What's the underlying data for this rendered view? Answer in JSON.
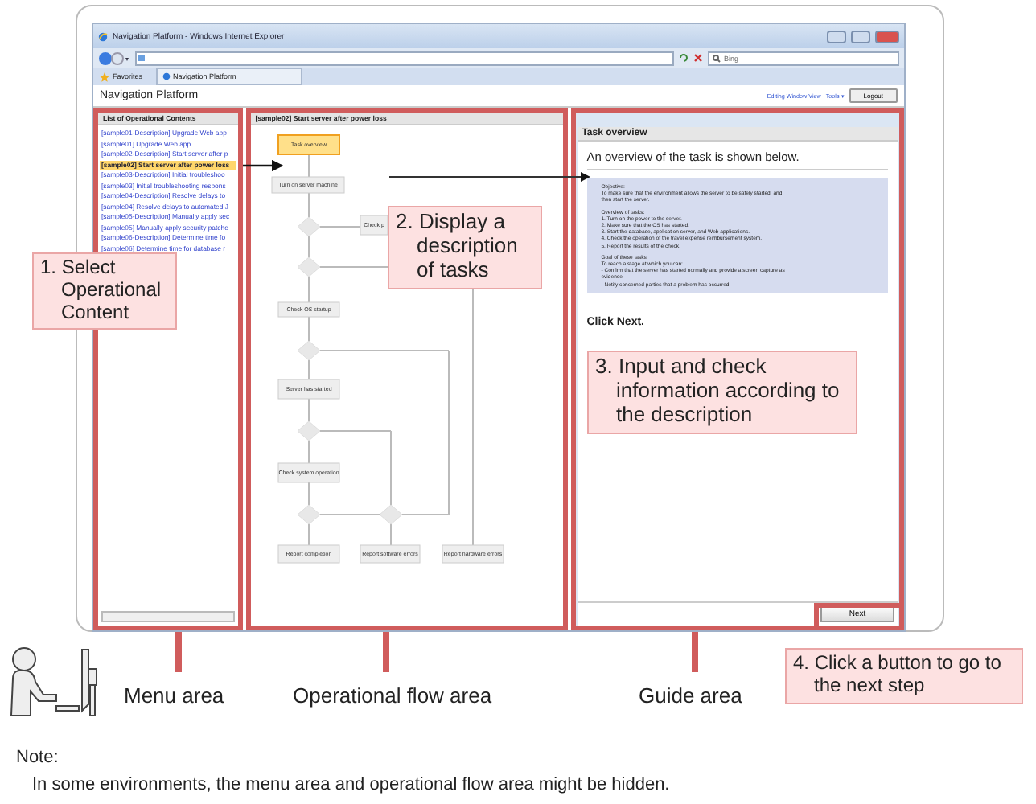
{
  "browser": {
    "title": "Navigation Platform - Windows Internet Explorer",
    "search_placeholder": "Bing",
    "favorites": "Favorites",
    "tab": "Navigation Platform"
  },
  "app": {
    "title": "Navigation Platform",
    "links": [
      "Editing Window View",
      "Tools ▾"
    ],
    "logout": "Logout"
  },
  "menu": {
    "heading": "List of Operational Contents",
    "items": [
      {
        "label": "[sample01-Description] Upgrade Web app",
        "selected": false
      },
      {
        "label": "[sample01] Upgrade Web app",
        "selected": false
      },
      {
        "label": "[sample02-Description] Start server after p",
        "selected": false
      },
      {
        "label": "[sample02] Start server after power loss",
        "selected": true
      },
      {
        "label": "[sample03-Description] Initial troubleshoo",
        "selected": false
      },
      {
        "label": "[sample03] Initial troubleshooting respons",
        "selected": false
      },
      {
        "label": "[sample04-Description] Resolve delays to",
        "selected": false
      },
      {
        "label": "[sample04] Resolve delays to automated J",
        "selected": false
      },
      {
        "label": "[sample05-Description] Manually apply sec",
        "selected": false
      },
      {
        "label": "[sample05] Manually apply security patche",
        "selected": false
      },
      {
        "label": "[sample06-Description] Determine time fo",
        "selected": false
      },
      {
        "label": "[sample06] Determine time for database r",
        "selected": false
      }
    ]
  },
  "flow": {
    "heading": "[sample02] Start server after power loss",
    "nodes": [
      {
        "label": "Task overview",
        "selected": true
      },
      {
        "label": "Turn on server machine",
        "selected": false
      },
      {
        "label": "Check p",
        "selected": false
      },
      {
        "label": "Check OS startup",
        "selected": false
      },
      {
        "label": "Server has started",
        "selected": false
      },
      {
        "label": "Check system operation",
        "selected": false
      },
      {
        "label": "Report completion",
        "selected": false
      },
      {
        "label": "Report software errors",
        "selected": false
      },
      {
        "label": "Report hardware errors",
        "selected": false
      }
    ]
  },
  "guide": {
    "heading": "Task overview",
    "intro": "An overview of the task is shown below.",
    "sections": [
      {
        "lines": [
          "Objective:",
          "To make sure that the environment allows the server to be safely started, and",
          "then start the server."
        ]
      },
      {
        "lines": [
          "Overview of tasks:",
          "1. Turn on the power to the server.",
          "2. Make sure that the OS has started.",
          "3. Start the database, application server, and Web applications.",
          "4. Check the operation of the travel expense reimbursement system.",
          "5. Report the results of the check."
        ]
      },
      {
        "lines": [
          "Goal of these tasks:",
          "To reach a stage at which you can:",
          "- Confirm that the server has started normally and provide a screen capture as",
          "evidence.",
          "- Notify concerned parties that a problem has occurred."
        ]
      }
    ],
    "instruction": "Click Next.",
    "button": "Next"
  },
  "callouts": [
    "1. Select Operational Content",
    "2. Display a description of tasks",
    "3. Input and check information according to the description",
    "4. Click a button to go to the next step"
  ],
  "area_labels": [
    "Menu area",
    "Operational flow area",
    "Guide area"
  ],
  "note": {
    "title": "Note:",
    "text": "In some environments, the menu area and operational flow area might be hidden."
  }
}
